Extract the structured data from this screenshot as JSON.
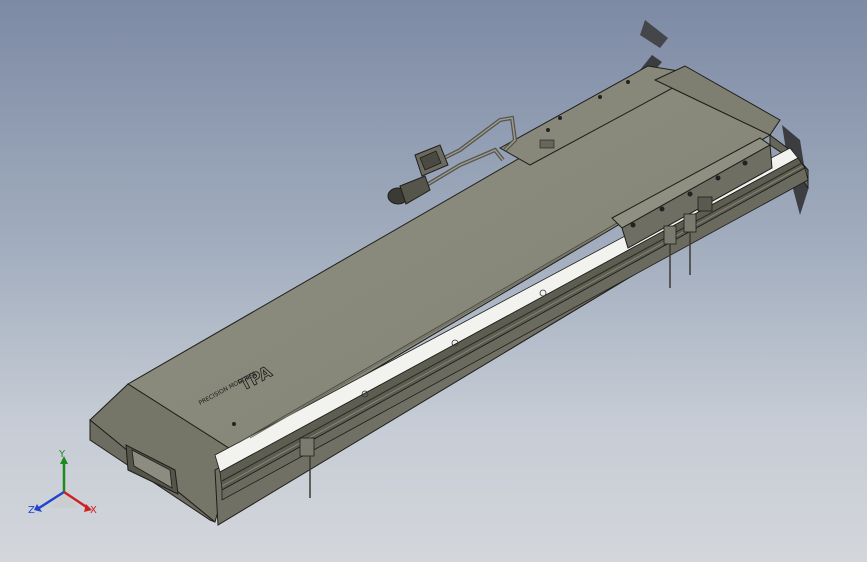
{
  "viewport": {
    "background_top": "#7d8aa4",
    "background_bottom": "#d3d6db"
  },
  "model": {
    "name": "linear-module-assembly",
    "body_color": "#7f7f72",
    "top_color": "#8a8a7c",
    "rail_color": "#5d5d52",
    "edge_color": "#1e1e1a",
    "label_text": "PRECISION MODULES",
    "logo_text": "TPA"
  },
  "triad": {
    "y_label": "Y",
    "z_label": "Z",
    "x_label": "X",
    "y_color": "#1e8a1e",
    "z_color": "#2244cc",
    "x_color": "#cc2222"
  }
}
